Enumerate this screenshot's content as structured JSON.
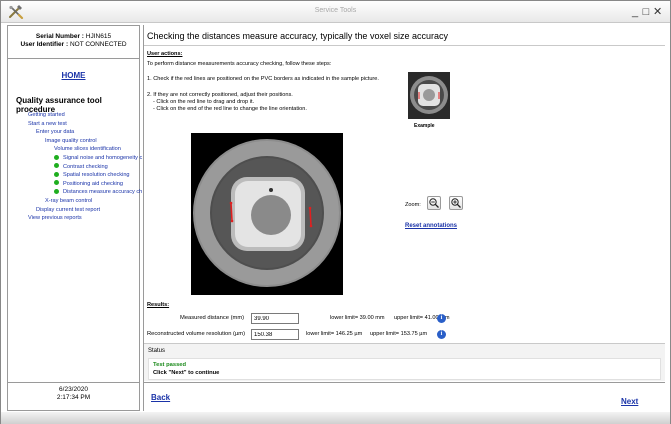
{
  "window": {
    "title": "Service Tools",
    "controls": {
      "minimize": "_",
      "maximize": "□",
      "close": "✕"
    }
  },
  "sidebar": {
    "serial_number_label": "Serial Number :",
    "serial_number_value": "HJIN615",
    "user_identifier_label": "User Identifier :",
    "user_identifier_value": "NOT CONNECTED",
    "home_label": "HOME",
    "section_title": "Quality assurance tool procedure",
    "tree": [
      {
        "label": "Getting started",
        "status": "none"
      },
      {
        "label": "Start a new test",
        "status": "none"
      },
      {
        "label": "Enter your data",
        "status": "none"
      },
      {
        "label": "Image quality control",
        "status": "none"
      },
      {
        "label": "Volume slices identification",
        "status": "none"
      },
      {
        "label": "Signal noise and homogeneity c",
        "status": "done"
      },
      {
        "label": "Contrast checking",
        "status": "done"
      },
      {
        "label": "Spatial resolution checking",
        "status": "done"
      },
      {
        "label": "Positioning aid checking",
        "status": "done"
      },
      {
        "label": "Distances measure accuracy ch",
        "status": "done"
      },
      {
        "label": "X-ray beam control",
        "status": "none"
      },
      {
        "label": "Display current test report",
        "status": "none"
      },
      {
        "label": "View previous reports",
        "status": "none"
      }
    ],
    "date": "6/23/2020",
    "time": "2:17:34 PM"
  },
  "main": {
    "title": "Checking the distances measure accuracy, typically the voxel size accuracy",
    "user_actions_label": "User actions:",
    "instructions": [
      "To perform distance measurements accuracy checking, follow these steps:",
      "1. Check if the red lines are positioned on the PVC borders as indicated in the sample picture.",
      "2. If they are not correctly positioned, adjust their positions.",
      "- Click on the red line to drag and drop it.",
      "- Click on the end of the red line to change the line orientation."
    ],
    "example_label": "Example",
    "zoom_label": "Zoom:",
    "reset_label": "Reset annotations",
    "results_label": "Results:",
    "results": [
      {
        "label": "Measured distance (mm)",
        "value": "39.90",
        "lower": "lower limit= 39.00 mm",
        "upper": "upper limit= 41.00 mm"
      },
      {
        "label": "Reconstructed volume resolution (µm)",
        "value": "150.38",
        "lower": "lower limit= 146.25 µm",
        "upper": "upper limit= 153.75 µm"
      }
    ],
    "status_label": "Status",
    "status_result": "Test passed",
    "status_message": "Click \"Next\" to continue",
    "back_label": "Back",
    "next_label": "Next"
  },
  "colors": {
    "link": "#1a33a8",
    "done_dot": "#1fae1f",
    "pass_text": "#1b8a1b",
    "measure_line": "#e02020",
    "info_icon": "#2a5fc8"
  },
  "icons": {
    "app": "tools-icon",
    "zoom_out": "zoom-out-icon",
    "zoom_in": "zoom-in-icon",
    "info": "info-icon"
  }
}
